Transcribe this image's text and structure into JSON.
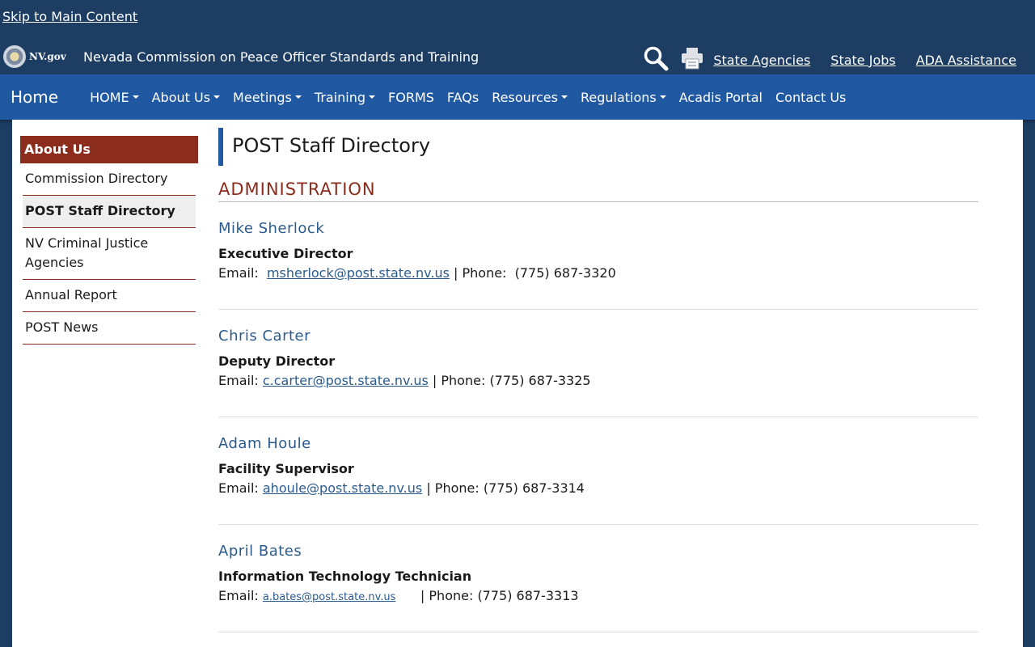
{
  "header": {
    "skip_link": "Skip to Main Content",
    "logo_text": "NV.gov",
    "agency_title": "Nevada Commission on Peace Officer Standards and Training",
    "utility_links": [
      "State Agencies",
      "State Jobs",
      "ADA Assistance"
    ],
    "search_icon": "search-icon",
    "print_icon": "printer-icon"
  },
  "nav": {
    "home": "Home",
    "items": [
      {
        "label": "HOME",
        "dropdown": true
      },
      {
        "label": "About Us",
        "dropdown": true
      },
      {
        "label": "Meetings",
        "dropdown": true
      },
      {
        "label": "Training",
        "dropdown": true
      },
      {
        "label": "FORMS",
        "dropdown": false
      },
      {
        "label": "FAQs",
        "dropdown": false
      },
      {
        "label": "Resources",
        "dropdown": true
      },
      {
        "label": "Regulations",
        "dropdown": true
      },
      {
        "label": "Acadis Portal",
        "dropdown": false
      },
      {
        "label": "Contact Us",
        "dropdown": false
      }
    ]
  },
  "sidebar": {
    "heading": "About Us",
    "items": [
      {
        "label": "Commission Directory"
      },
      {
        "label": "POST Staff Directory"
      },
      {
        "label": "NV Criminal Justice Agencies"
      },
      {
        "label": "Annual Report"
      },
      {
        "label": "POST News"
      }
    ]
  },
  "main": {
    "page_title": "POST Staff Directory",
    "section": "ADMINISTRATION",
    "staff": [
      {
        "name": "Mike Sherlock",
        "title": "Executive Director",
        "email_label": "Email:  ",
        "email": "msherlock@post.state.nv.us",
        "phone_label": " | Phone:  ",
        "phone": "(775) 687-3320"
      },
      {
        "name": "Chris Carter",
        "title": "Deputy Director",
        "email_label": "Email: ",
        "email": "c.carter@post.state.nv.us",
        "phone_label": " | Phone: ",
        "phone": "(775) 687-3325"
      },
      {
        "name": "Adam Houle",
        "title": "Facility Supervisor",
        "email_label": "Email: ",
        "email": "ahoule@post.state.nv.us",
        "phone_label": " | Phone: ",
        "phone": "(775) 687-3314"
      },
      {
        "name": "April Bates",
        "title": "Information Technology Technician",
        "email_label": "Email: ",
        "email": "a.bates@post.state.nv.us",
        "phone_label": "      | Phone: ",
        "phone": "(775) 687-3313"
      }
    ]
  },
  "colors": {
    "header_bg": "#1d3d63",
    "nav_bg": "#2058a1",
    "accent_red": "#8b2c1c",
    "name_blue": "#2b5b8c"
  }
}
